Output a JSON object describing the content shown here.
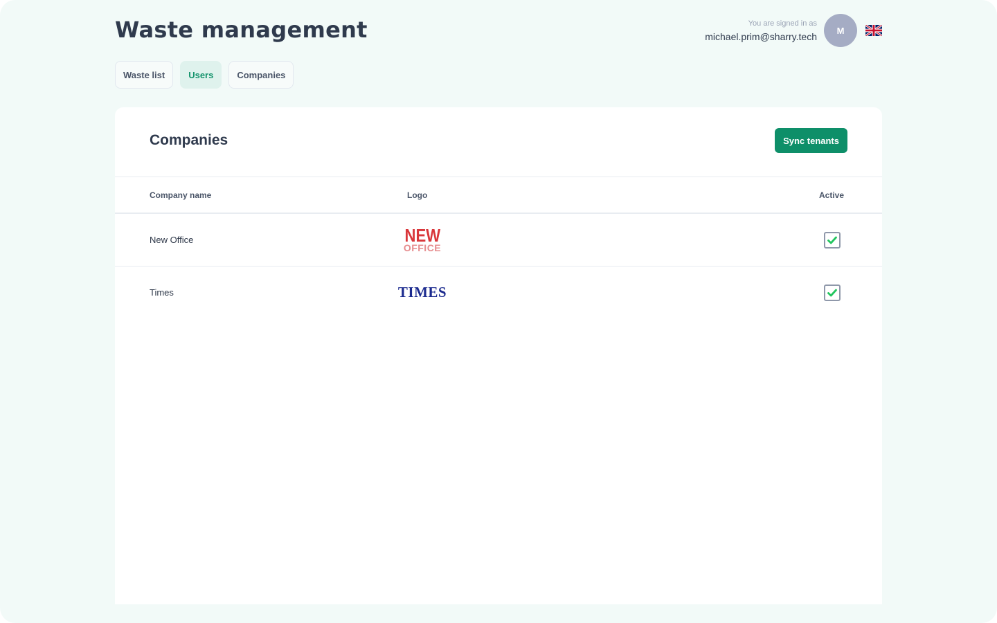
{
  "app": {
    "title": "Waste management"
  },
  "user": {
    "signed_in_label": "You are signed in as",
    "email": "michael.prim@sharry.tech",
    "avatar_initial": "M",
    "language_icon": "uk-flag-icon"
  },
  "tabs": [
    {
      "label": "Waste list",
      "active": false
    },
    {
      "label": "Users",
      "active": true
    },
    {
      "label": "Companies",
      "active": false
    }
  ],
  "companies": {
    "title": "Companies",
    "sync_button": "Sync tenants",
    "columns": {
      "name": "Company name",
      "logo": "Logo",
      "active": "Active"
    },
    "rows": [
      {
        "name": "New Office",
        "logo": {
          "line1": "NEW",
          "line2": "OFFICE"
        },
        "active": true
      },
      {
        "name": "Times",
        "logo": {
          "text": "TIMES"
        },
        "active": true
      }
    ]
  },
  "colors": {
    "accent": "#0e8f69",
    "active_tab_bg": "#dff2ed",
    "check": "#22c55e",
    "background": "#f2faf8"
  }
}
